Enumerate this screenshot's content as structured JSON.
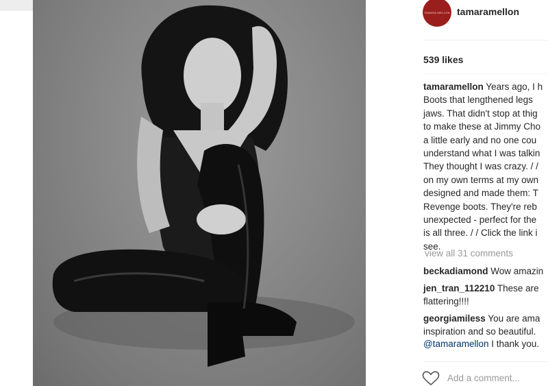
{
  "post": {
    "photo_alt": "",
    "avatar_text": "TAMARA MELLON",
    "username": "tamaramellon",
    "likes": "539 likes",
    "caption_user": "tamaramellon",
    "caption_lines": [
      " Years ago, I h",
      "Boots that lengthened legs",
      "jaws. That didn't stop at thig",
      "to make these at Jimmy Cho",
      "a little early and no one cou",
      "understand what I was talkin",
      "They thought I was crazy. / /",
      "on my own terms at my own",
      "designed and made them: T",
      "Revenge boots. They're reb",
      "unexpected - perfect for the",
      "is all three. / / Click the link i",
      "see."
    ],
    "view_all": "view all 31 comments",
    "comments": [
      {
        "user": "beckadiamond",
        "lines": [
          " Wow amazin"
        ]
      },
      {
        "user": "jen_tran_112210",
        "lines": [
          " These are",
          "flattering!!!!"
        ]
      },
      {
        "user": "georgiamiless",
        "lines": [
          " You are ama",
          "inspiration and so beautiful."
        ],
        "mention": "@tamaramellon",
        "mention_tail": " I thank you."
      }
    ],
    "add_comment_placeholder": "Add a comment..."
  },
  "colors": {
    "avatar_bg": "#9a1f1c",
    "link": "#003569",
    "muted": "#999999"
  }
}
